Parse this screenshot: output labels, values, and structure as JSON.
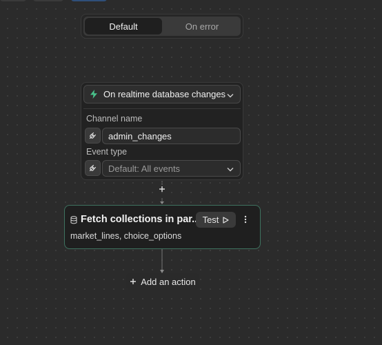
{
  "tabs": {
    "default_label": "Default",
    "on_error_label": "On error"
  },
  "trigger": {
    "title": "On realtime database changes",
    "channel_label": "Channel name",
    "channel_value": "admin_changes",
    "event_label": "Event type",
    "event_value": "Default: All events"
  },
  "action": {
    "title": "Fetch collections in par...",
    "test_label": "Test",
    "subtitle": "market_lines, choice_options"
  },
  "add_action_label": "Add an action",
  "colors": {
    "canvas": "#2b2b2b",
    "accent_green": "#3f7360",
    "bolt_green": "#49c28b"
  }
}
